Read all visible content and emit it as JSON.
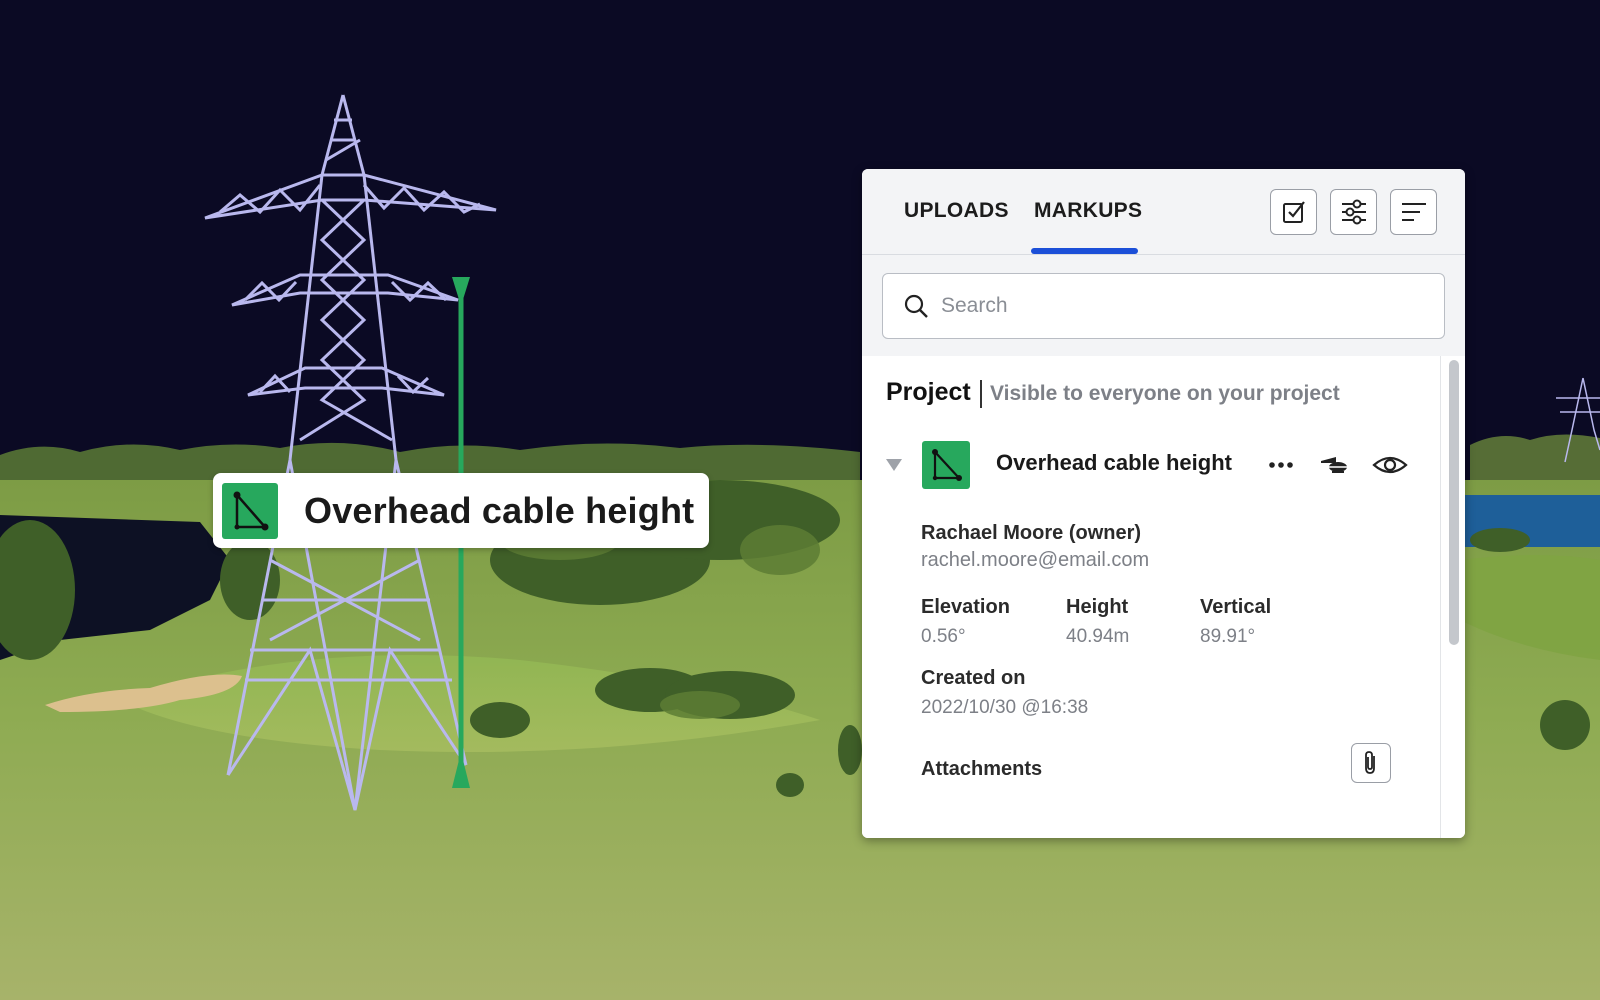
{
  "map_label": {
    "text": "Overhead cable height"
  },
  "panel": {
    "tabs": [
      {
        "label": "UPLOADS",
        "active": false
      },
      {
        "label": "MARKUPS",
        "active": true
      }
    ],
    "toolbar_icons": [
      "checkbox-icon",
      "sliders-icon",
      "sort-lines-icon"
    ],
    "search": {
      "placeholder": "Search",
      "value": ""
    },
    "section": {
      "title": "Project",
      "subtitle": "Visible to everyone on your project"
    },
    "item": {
      "icon": "measure-triangle-icon",
      "title": "Overhead cable height",
      "owner": "Rachael Moore (owner)",
      "email": "rachel.moore@email.com",
      "metrics": [
        {
          "label": "Elevation",
          "value": "0.56°"
        },
        {
          "label": "Height",
          "value": "40.94m"
        },
        {
          "label": "Vertical",
          "value": "89.91°"
        }
      ],
      "created_label": "Created on",
      "created_value": "2022/10/30 @16:38",
      "attachments_label": "Attachments"
    }
  },
  "colors": {
    "accent": "#1b4fd8",
    "markup_green": "#27a85d",
    "sky": "#0b0a24",
    "grass": "#8fae4f",
    "tower": "#b9b8ee"
  }
}
